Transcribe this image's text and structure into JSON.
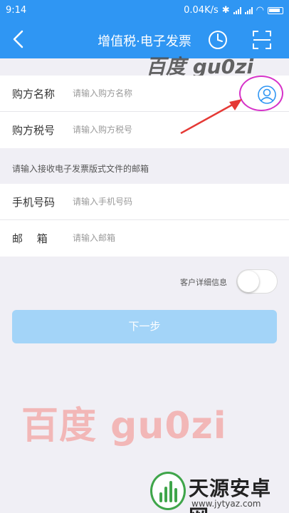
{
  "status_bar": {
    "time": "9:14",
    "network_speed": "0.04K/s"
  },
  "nav": {
    "title": "增值税·电子发票",
    "back_icon": "back-arrow",
    "history_icon": "clock",
    "scan_icon": "scan-frame"
  },
  "watermark_top": "百度 gu0zi",
  "buyer": {
    "name_label": "购方名称",
    "name_placeholder": "请输入购方名称",
    "tax_label": "购方税号",
    "tax_placeholder": "请输入购方税号",
    "contact_icon": "user-circle"
  },
  "email_section_hint": "请输入接收电子发票版式文件的邮箱",
  "contact": {
    "phone_label": "手机号码",
    "phone_placeholder": "请输入手机号码",
    "email_label": "邮　 箱",
    "email_placeholder": "请输入邮箱"
  },
  "customer_detail": {
    "label": "客户详细信息",
    "enabled": false
  },
  "next_button": "下一步",
  "watermark_big": "百度 gu0zi",
  "footer_logo": {
    "name": "天源安卓网",
    "url": "www.jytyaz.com"
  },
  "colors": {
    "primary": "#2f96f3",
    "button_disabled": "#a3d4f8",
    "highlight": "#d633c9",
    "arrow": "#e53935"
  }
}
